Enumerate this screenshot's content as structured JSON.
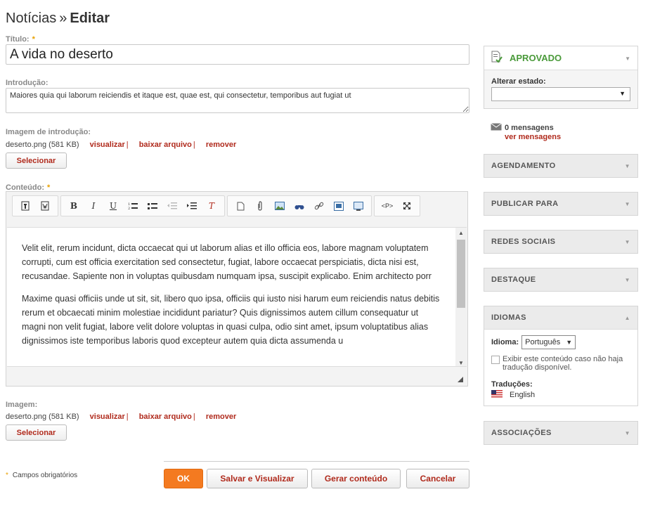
{
  "header": {
    "section": "Notícias",
    "separator": "»",
    "action": "Editar"
  },
  "form": {
    "required_marker": "*",
    "title_label": "Título:",
    "title_value": "A vida no deserto",
    "intro_label": "Introdução:",
    "intro_value": "Maiores quia qui laborum reiciendis et itaque est, quae est, qui consectetur, temporibus aut fugiat ut",
    "intro_image_label": "Imagem de introdução:",
    "intro_image": {
      "file": "deserto.png (581 KB)",
      "view": "visualizar",
      "download": "baixar arquivo",
      "remove": "remover",
      "pipe": "|"
    },
    "select_button": "Selecionar",
    "content_label": "Conteúdo:",
    "content_paragraphs": [
      "Velit elit, rerum incidunt, dicta occaecat qui ut laborum alias et illo officia eos, labore magnam voluptatem corrupti, cum est officia exercitation sed consectetur, fugiat, labore occaecat perspiciatis, dicta nisi est, recusandae. Sapiente non in voluptas quibusdam numquam ipsa, suscipit explicabo. Enim architecto porr",
      "Maxime quasi officiis unde ut sit, sit, libero quo ipsa, officiis qui iusto nisi harum eum reiciendis natus debitis rerum et obcaecati minim molestiae incididunt pariatur? Quis dignissimos autem cillum consequatur ut magni non velit fugiat, labore velit dolore voluptas in quasi culpa, odio sint amet, ipsum voluptatibus alias dignissimos iste temporibus laboris quod excepteur autem quia dicta assumenda u"
    ],
    "image_label": "Imagem:",
    "image": {
      "file": "deserto.png (581 KB)",
      "view": "visualizar",
      "download": "baixar arquivo",
      "remove": "remover",
      "pipe": "|"
    },
    "required_note": "Campos obrigatórios"
  },
  "toolbar": {
    "bold": "B",
    "italic": "I",
    "underline": "U",
    "remove_format": "T",
    "source": "<P>"
  },
  "footer_buttons": {
    "ok": "OK",
    "save_preview": "Salvar e Visualizar",
    "generate": "Gerar conteúdo",
    "cancel": "Cancelar"
  },
  "sidebar": {
    "status": "APROVADO",
    "change_state_label": "Alterar estado:",
    "messages_count": "0 mensagens",
    "messages_link": "ver mensagens",
    "panels": [
      "AGENDAMENTO",
      "PUBLICAR PARA",
      "REDES SOCIAIS",
      "DESTAQUE"
    ],
    "languages_title": "IDIOMAS",
    "language_label": "Idioma:",
    "language_value": "Português",
    "show_unavailable": "Exibir este conteúdo caso não haja tradução disponível.",
    "translations_label": "Traduções:",
    "translation_english": "English",
    "associations_title": "ASSOCIAÇÕES"
  },
  "colors": {
    "accent": "#f47a20",
    "link": "#b02a1c",
    "approved": "#4a9a3a"
  }
}
